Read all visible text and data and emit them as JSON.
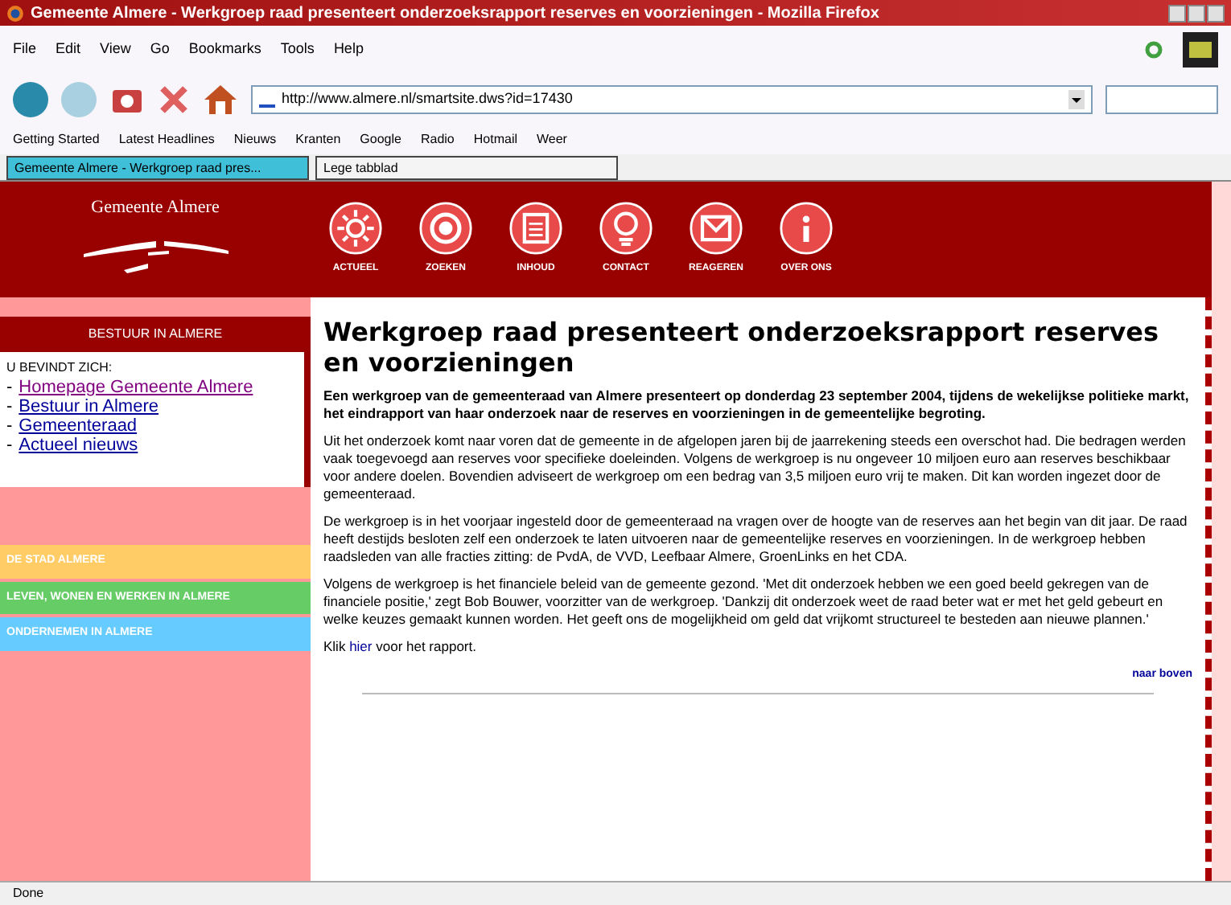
{
  "window": {
    "title": "Gemeente Almere - Werkgroep raad presenteert onderzoeksrapport reserves en voorzieningen - Mozilla Firefox"
  },
  "menu": [
    "File",
    "Edit",
    "View",
    "Go",
    "Bookmarks",
    "Tools",
    "Help"
  ],
  "address": {
    "value": "http://www.almere.nl/smartsite.dws?id=17430"
  },
  "bookmarks": [
    "Getting Started",
    "Latest Headlines",
    "Nieuws",
    "Kranten",
    "Google",
    "Radio",
    "Hotmail",
    "Weer"
  ],
  "tabs": [
    {
      "label": "Gemeente Almere - Werkgroep raad pres...",
      "selected": true
    },
    {
      "label": "Lege tabblad",
      "selected": false
    }
  ],
  "site": {
    "logo": "Gemeente Almere",
    "nav": [
      "ACTUEEL",
      "ZOEKEN",
      "INHOUD",
      "CONTACT",
      "REAGEREN",
      "OVER ONS"
    ]
  },
  "sidebar": {
    "heading": "BESTUUR IN ALMERE",
    "trail_label": "U BEVINDT ZICH:",
    "links": [
      {
        "bullet": "-",
        "label": "Homepage Gemeente Almere",
        "visited": true
      },
      {
        "bullet": "-",
        "label": "Bestuur in Almere",
        "visited": false
      },
      {
        "bullet": "-",
        "label": "Gemeenteraad",
        "visited": false
      },
      {
        "bullet": "-",
        "label": "Actueel nieuws",
        "visited": false
      }
    ],
    "sections": [
      {
        "label": "DE STAD ALMERE",
        "color": "#ffcc66"
      },
      {
        "label": "LEVEN, WONEN EN WERKEN IN ALMERE",
        "color": "#66cc66"
      },
      {
        "label": "ONDERNEMEN IN ALMERE",
        "color": "#66ccff"
      }
    ]
  },
  "article": {
    "title": "Werkgroep raad presenteert onderzoeksrapport reserves en voorzieningen",
    "lead": "Een werkgroep van de gemeenteraad van Almere presenteert op donderdag 23 september 2004, tijdens de wekelijkse politieke markt, het eindrapport van haar onderzoek naar de reserves en voorzieningen in de gemeentelijke begroting.",
    "paragraphs": [
      "Uit het onderzoek komt naar voren dat de gemeente in de afgelopen jaren bij de jaarrekening steeds een overschot had. Die bedragen werden vaak toegevoegd aan reserves voor specifieke doeleinden. Volgens de werkgroep is nu ongeveer 10 miljoen euro aan reserves beschikbaar voor andere doelen. Bovendien adviseert de werkgroep om een bedrag van 3,5 miljoen euro vrij te maken. Dit kan worden ingezet door de gemeenteraad.",
      "De werkgroep is in het voorjaar ingesteld door de gemeenteraad na vragen over de hoogte van de reserves aan het begin van dit jaar. De raad heeft destijds besloten zelf een onderzoek te laten uitvoeren naar de gemeentelijke reserves en voorzieningen. In de werkgroep hebben raadsleden van alle fracties zitting: de PvdA, de VVD, Leefbaar Almere, GroenLinks en het CDA.",
      "Volgens de werkgroep is het financiele beleid van de gemeente gezond. 'Met dit onderzoek hebben we een goed beeld gekregen van de financiele positie,' zegt Bob Bouwer, voorzitter van de werkgroep. 'Dankzij dit onderzoek weet de raad beter wat er met het geld gebeurt en welke keuzes gemaakt kunnen worden. Het geeft ons de mogelijkheid om geld dat vrijkomt structureel te besteden aan nieuwe plannen.'"
    ],
    "more": {
      "before": "Klik ",
      "link": "hier",
      "after": " voor het rapport."
    },
    "top_link": "naar boven"
  },
  "status": "Done"
}
